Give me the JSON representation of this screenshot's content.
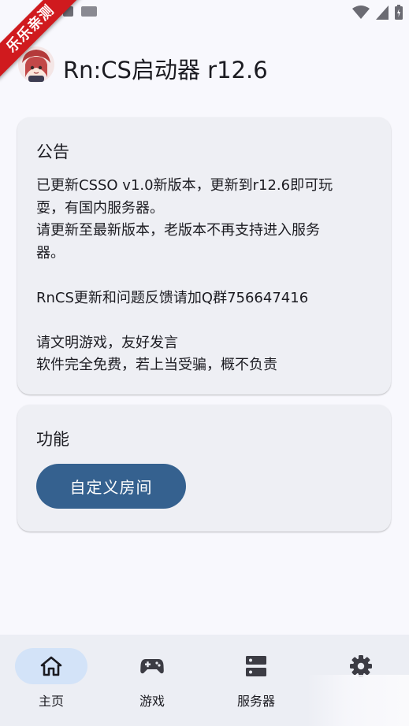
{
  "badge": {
    "text": "乐乐亲测"
  },
  "app": {
    "title": "Rn:CS启动器 r12.6"
  },
  "notice": {
    "title": "公告",
    "lines": [
      "已更新CSSO v1.0新版本，更新到r12.6即可玩",
      "耍，有国内服务器。",
      "请更新至最新版本，老版本不再支持进入服务",
      "器。",
      "",
      "RnCS更新和问题反馈请加Q群756647416",
      "",
      "请文明游戏，友好发言",
      "软件完全免费，若上当受骗，概不负责"
    ]
  },
  "features": {
    "title": "功能",
    "custom_room_button": "自定义房间"
  },
  "nav": {
    "items": [
      {
        "label": "主页",
        "icon": "home-icon",
        "active": true
      },
      {
        "label": "游戏",
        "icon": "gamepad-icon",
        "active": false
      },
      {
        "label": "服务器",
        "icon": "server-icon",
        "active": false
      },
      {
        "label": "",
        "icon": "gear-icon",
        "active": false
      }
    ]
  },
  "colors": {
    "accent": "#35618f",
    "nav_active_pill": "#d3e3f8",
    "card_bg": "#eeeff4",
    "badge_red": "#d01a1e"
  }
}
